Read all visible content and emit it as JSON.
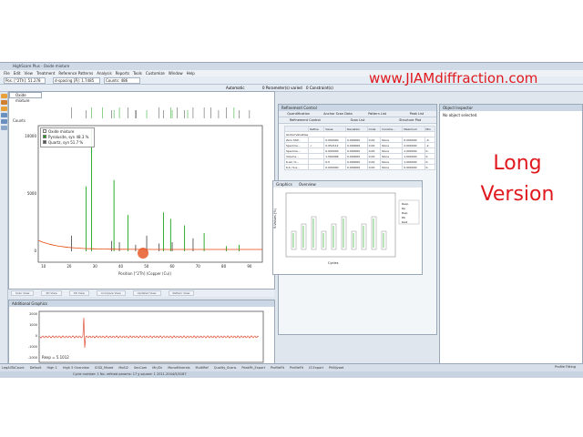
{
  "app": {
    "title": "HighScore Plus - Oxide mixture",
    "menu": [
      "File",
      "Edit",
      "View",
      "Treatment",
      "Reference Patterns",
      "Analysis",
      "Reports",
      "Tools",
      "Customize",
      "Window",
      "Help"
    ],
    "pos_field": "Pos. [°2Th]: 51.278",
    "dspacing_field": "d-spacing [Å]: 1.7485",
    "counts_field": "Counts: 486",
    "params_varied": "0 Parameter(s) varied",
    "constraints": "0 Constraint(s)",
    "automatic": "Automatic"
  },
  "doc": {
    "tab_label": "Oxide mixture",
    "y_label": "Counts",
    "x_label": "Position [°2Th] (Copper (Cu))",
    "y_ticks": [
      "10000",
      "5000",
      "0"
    ],
    "x_ticks": [
      "10",
      "20",
      "30",
      "40",
      "50",
      "60",
      "70",
      "80",
      "90"
    ],
    "legend": [
      {
        "label": "Oxide mixture",
        "color": "#ffffff"
      },
      {
        "label": "Pyrolusite, syn 48.3 %",
        "color": "#1aa31a"
      },
      {
        "label": "Quartz, syn 51.7 %",
        "color": "#555555"
      }
    ],
    "bottom_tabs": [
      "Scan View",
      "2D View",
      "3D View",
      "Compare View",
      "Updated View",
      "Pattern View"
    ]
  },
  "additional_graphics": {
    "title": "Additional Graphics",
    "y_ticks": [
      "2000",
      "1000",
      "0",
      "-1000",
      "-2000"
    ],
    "rexp_label": "Rexp = 5.1012"
  },
  "refinement": {
    "title": "Refinement Control",
    "tabs": [
      "Quantification",
      "Anchor Scan Data",
      "Pattern List",
      "Peak List"
    ],
    "tabs2": [
      "Refinement Control",
      "Scan List",
      "Structure Plot"
    ],
    "headers": [
      "",
      "Refine",
      "Value",
      "Deviation",
      "Code",
      "Constra...",
      "Maximum",
      "Min"
    ],
    "group": "Global Variables",
    "rows": [
      [
        "Zero Shif...",
        "",
        "0.000000",
        "0.000000",
        "0.00",
        "None",
        "0.000000",
        "-0."
      ],
      [
        "Specime...",
        "✓",
        "0.052112",
        "0.000000",
        "0.00",
        "None",
        "2.000000",
        "-2."
      ],
      [
        "Specime...",
        "",
        "0.000000",
        "0.000000",
        "0.00",
        "None",
        "1.000000",
        "0."
      ],
      [
        "Volume...",
        "",
        "1.560996",
        "0.000000",
        "0.00",
        "None",
        "1.000000",
        "0."
      ],
      [
        "K-a2 / K...",
        "",
        "0.5",
        "0.000000",
        "0.00",
        "None",
        "1.000000",
        "0."
      ],
      [
        "K-b / K-a...",
        "",
        "0.000000",
        "0.000000",
        "0.00",
        "None",
        "0.000000",
        "0."
      ]
    ]
  },
  "graphics_panel": {
    "tabs": [
      "Graphics",
      "Overview"
    ],
    "y_label": "R-Values (%)",
    "x_label": "Cycles",
    "legend": [
      "Rexp",
      "Rp",
      "Rwp",
      "Rb",
      "Rw2"
    ]
  },
  "object_inspector": {
    "title": "Object Inspector",
    "message": "No object selected."
  },
  "status": {
    "tabs": [
      "LegAllToCount",
      "Default",
      "High 1",
      "High 3 Overview",
      "ICSD_Mixed",
      "MoSi2",
      "SecCom",
      "Mn/Zn",
      "MonoMinerals",
      "MultiRef",
      "Quality_Scans",
      "PeakFit_Export",
      "ProfileFit",
      "ProfileFit",
      "LT-Export",
      "PhBijvoet"
    ],
    "info": "Cycle number: 1    No. refined params: 17    χ square: 1    2011-2044/5/0187",
    "profile_fitting": "Profile Fitting"
  },
  "overlay": {
    "website": "www.JIAMdiffraction.com",
    "long_version": "Long Version"
  },
  "colors": {
    "overlay_red": "#e0191e",
    "pyrolusite": "#1aa31a",
    "quartz": "#555555",
    "background_curve": "#e8480c",
    "difference": "#d8371a"
  }
}
